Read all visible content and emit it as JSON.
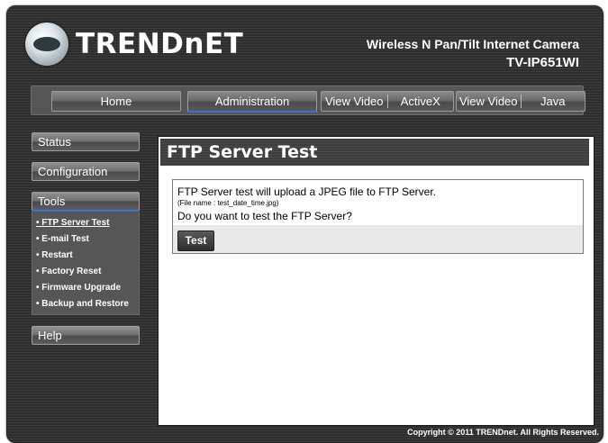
{
  "header": {
    "brand": "TRENDnET",
    "product_name": "Wireless N Pan/Tilt Internet Camera",
    "model": "TV-IP651WI"
  },
  "nav": {
    "home": "Home",
    "administration": "Administration",
    "view_video_activex": [
      "View Video",
      "ActiveX"
    ],
    "view_video_java": [
      "View Video",
      "Java"
    ]
  },
  "sidebar": {
    "status": "Status",
    "configuration": "Configuration",
    "tools": "Tools",
    "tools_items": [
      "• FTP Server Test",
      "• E-mail Test",
      "• Restart",
      "• Factory Reset",
      "• Firmware Upgrade",
      "• Backup and Restore"
    ],
    "help": "Help"
  },
  "content": {
    "title": "FTP Server Test",
    "description": "FTP Server test will upload a JPEG file to FTP Server.",
    "file_note": "(File name : test_date_time.jpg)",
    "question": "Do you want to test the FTP Server?",
    "test_button": "Test"
  },
  "footer": {
    "copyright": "Copyright © 2011 TRENDnet. All Rights Reserved."
  }
}
